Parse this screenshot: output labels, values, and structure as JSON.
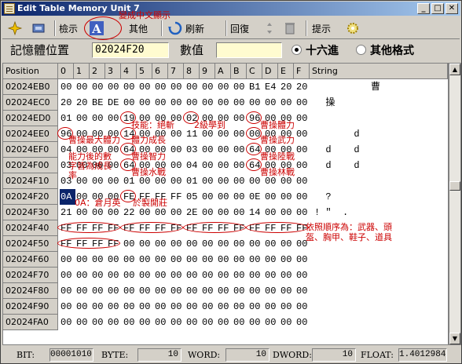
{
  "window": {
    "title": "Edit Table  Memory Unit 7",
    "controls": [
      "_",
      "□",
      "✕"
    ]
  },
  "toolbar": {
    "view_label": "檢示",
    "other_label": "其他",
    "refresh_label": "刷新",
    "restore_label": "回復",
    "hint_label": "提示"
  },
  "addressbar": {
    "address_label": "記憶體位置",
    "address_value": "02024F20",
    "value_label": "數值",
    "value_value": "",
    "radio_hex_label": "十六進",
    "radio_other_label": "其他格式",
    "hex_selected": true
  },
  "grid": {
    "headers": [
      "Position",
      "0",
      "1",
      "2",
      "3",
      "4",
      "5",
      "6",
      "7",
      "8",
      "9",
      "A",
      "B",
      "C",
      "D",
      "E",
      "F",
      "String"
    ],
    "rows": [
      {
        "pos": "02024EB0",
        "cells": [
          "00",
          "00",
          "00",
          "00",
          "00",
          "00",
          "00",
          "00",
          "00",
          "00",
          "00",
          "00",
          "B1",
          "E4",
          "20",
          "20"
        ],
        "str": "          曹"
      },
      {
        "pos": "02024EC0",
        "cells": [
          "20",
          "20",
          "BE",
          "DE",
          "00",
          "00",
          "00",
          "00",
          "00",
          "00",
          "00",
          "00",
          "00",
          "00",
          "00",
          "00"
        ],
        "str": "  操"
      },
      {
        "pos": "02024ED0",
        "cells": [
          "01",
          "00",
          "00",
          "00",
          "19",
          "00",
          "00",
          "00",
          "02",
          "00",
          "00",
          "00",
          "96",
          "00",
          "00",
          "00"
        ],
        "str": ""
      },
      {
        "pos": "02024EE0",
        "cells": [
          "96",
          "00",
          "00",
          "00",
          "14",
          "00",
          "00",
          "00",
          "11",
          "00",
          "00",
          "00",
          "00",
          "00",
          "00",
          "00"
        ],
        "str": "       d"
      },
      {
        "pos": "02024EF0",
        "cells": [
          "04",
          "00",
          "00",
          "00",
          "64",
          "00",
          "00",
          "00",
          "03",
          "00",
          "00",
          "00",
          "64",
          "00",
          "00",
          "00"
        ],
        "str": "  d    d"
      },
      {
        "pos": "02024F00",
        "cells": [
          "03",
          "00",
          "00",
          "00",
          "64",
          "00",
          "00",
          "00",
          "04",
          "00",
          "00",
          "00",
          "64",
          "00",
          "00",
          "00"
        ],
        "str": "  d    d"
      },
      {
        "pos": "02024F10",
        "cells": [
          "03",
          "00",
          "00",
          "00",
          "01",
          "00",
          "00",
          "00",
          "01",
          "00",
          "00",
          "00",
          "00",
          "00",
          "00",
          "00"
        ],
        "str": ""
      },
      {
        "pos": "02024F20",
        "cells": [
          "0A",
          "00",
          "00",
          "00",
          "FE",
          "FF",
          "FF",
          "FF",
          "05",
          "00",
          "00",
          "00",
          "0E",
          "00",
          "00",
          "00"
        ],
        "str": "  ?"
      },
      {
        "pos": "02024F30",
        "cells": [
          "21",
          "00",
          "00",
          "00",
          "22",
          "00",
          "00",
          "00",
          "2E",
          "00",
          "00",
          "00",
          "14",
          "00",
          "00",
          "00"
        ],
        "str": "! \"  ."
      },
      {
        "pos": "02024F40",
        "cells": [
          "FF",
          "FF",
          "FF",
          "FF",
          "FF",
          "FF",
          "FF",
          "FF",
          "FF",
          "FF",
          "FF",
          "FF",
          "FF",
          "FF",
          "FF",
          "FF"
        ],
        "str": ""
      },
      {
        "pos": "02024F50",
        "cells": [
          "FF",
          "FF",
          "FF",
          "FF",
          "00",
          "00",
          "00",
          "00",
          "00",
          "00",
          "00",
          "00",
          "00",
          "00",
          "00",
          "00"
        ],
        "str": ""
      },
      {
        "pos": "02024F60",
        "cells": [
          "00",
          "00",
          "00",
          "00",
          "00",
          "00",
          "00",
          "00",
          "00",
          "00",
          "00",
          "00",
          "00",
          "00",
          "00",
          "00"
        ],
        "str": ""
      },
      {
        "pos": "02024F70",
        "cells": [
          "00",
          "00",
          "00",
          "00",
          "00",
          "00",
          "00",
          "00",
          "00",
          "00",
          "00",
          "00",
          "00",
          "00",
          "00",
          "00"
        ],
        "str": ""
      },
      {
        "pos": "02024F80",
        "cells": [
          "00",
          "00",
          "00",
          "00",
          "00",
          "00",
          "00",
          "00",
          "00",
          "00",
          "00",
          "00",
          "00",
          "00",
          "00",
          "00"
        ],
        "str": ""
      },
      {
        "pos": "02024F90",
        "cells": [
          "00",
          "00",
          "00",
          "00",
          "00",
          "00",
          "00",
          "00",
          "00",
          "00",
          "00",
          "00",
          "00",
          "00",
          "00",
          "00"
        ],
        "str": ""
      },
      {
        "pos": "02024FA0",
        "cells": [
          "00",
          "00",
          "00",
          "00",
          "00",
          "00",
          "00",
          "00",
          "00",
          "00",
          "00",
          "00",
          "00",
          "00",
          "00",
          "00"
        ],
        "str": ""
      }
    ],
    "selected_row": 7,
    "selected_col": 0
  },
  "annotations": {
    "a1": "變成中文顯示",
    "a2": "技能：絕斬",
    "a3": "2級學到",
    "a4": "曹操體力",
    "a5": "曹操最大體力",
    "a6": "體力成長",
    "a7": "曹操武力",
    "a8": "能力後的數",
    "a9": "曹操智力",
    "a10": "曹操陸戰",
    "a11": "字皆為成長",
    "a12": "率",
    "a13": "曹操水戰",
    "a14": "曹操林戰",
    "a15": "0A：倉月英",
    "a16": "於製開莊",
    "a17": "依照順序為：武器、頭",
    "a18": "盔、胸甲、鞋子、道具"
  },
  "status": {
    "bit_label": "BIT:",
    "bit_value": "00001010",
    "byte_label": "BYTE:",
    "byte_value": "10",
    "word_label": "WORD:",
    "word_value": "10",
    "dword_label": "DWORD:",
    "dword_value": "10",
    "float_label": "FLOAT:",
    "float_value": "1.4012984"
  }
}
